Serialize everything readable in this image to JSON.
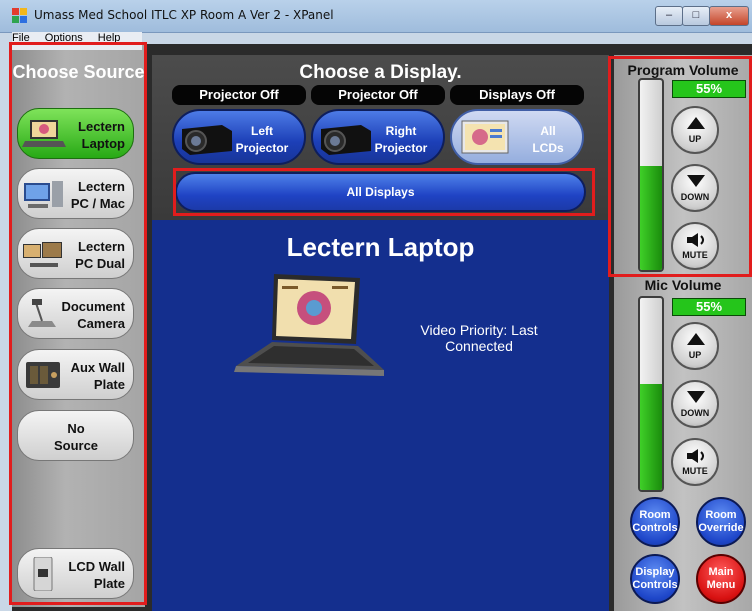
{
  "window": {
    "title": "Umass Med School ITLC XP Room A Ver 2 - XPanel",
    "controls": {
      "minimize": "–",
      "maximize": "□",
      "close": "x"
    }
  },
  "menu": [
    "File",
    "Options",
    "Help"
  ],
  "source_panel": {
    "heading": "Choose Source",
    "items": [
      {
        "label": "Lectern Laptop",
        "icon": "laptop-icon",
        "active": true
      },
      {
        "label": "Lectern PC / Mac",
        "icon": "desktop-pc-icon",
        "active": false
      },
      {
        "label": "Lectern PC Dual",
        "icon": "dual-pc-icon",
        "active": false
      },
      {
        "label": "Document Camera",
        "icon": "document-camera-icon",
        "active": false
      },
      {
        "label": "Aux Wall Plate",
        "icon": "wall-plate-icon",
        "active": false
      },
      {
        "label": "No Source",
        "icon": "",
        "active": false
      },
      {
        "label": "LCD Wall Plate",
        "icon": "lcd-wall-plate-icon",
        "active": false
      }
    ]
  },
  "display_panel": {
    "heading": "Choose a Display.",
    "status": [
      "Projector Off",
      "Projector Off",
      "Displays Off"
    ],
    "buttons": [
      {
        "label": "Left Projector",
        "icon": "projector-icon"
      },
      {
        "label": "Right Projector",
        "icon": "projector-icon"
      },
      {
        "label": "All LCDs",
        "icon": "lcd-icon"
      }
    ],
    "all_displays": "All Displays"
  },
  "main": {
    "current_source": "Lectern Laptop",
    "video_priority": "Video Priority: Last Connected"
  },
  "program_volume": {
    "title": "Program Volume",
    "percent": "55%",
    "level": 0.55,
    "up": "UP",
    "down": "DOWN",
    "mute": "MUTE"
  },
  "mic_volume": {
    "title": "Mic Volume",
    "percent": "55%",
    "level": 0.55,
    "up": "UP",
    "down": "DOWN",
    "mute": "MUTE"
  },
  "bottom_buttons": {
    "room_controls": "Room Controls",
    "room_override": "Room Override",
    "display_controls": "Display Controls",
    "main_menu": "Main Menu"
  },
  "colors": {
    "accent_blue": "#1c3fb7",
    "active_green": "#27a915",
    "annotation_red": "#e11d1d",
    "main_menu_red": "#d81111"
  }
}
